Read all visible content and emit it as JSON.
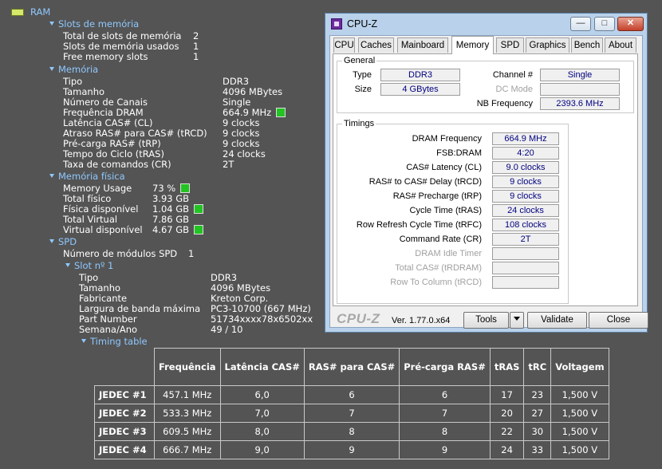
{
  "tree": {
    "ram": "RAM",
    "slots": {
      "header": "Slots de memória",
      "rows": [
        {
          "label": "Total de slots de memória",
          "value": "2"
        },
        {
          "label": "Slots de memória usados",
          "value": "1"
        },
        {
          "label": "Free memory slots",
          "value": "1"
        }
      ]
    },
    "memoria": {
      "header": "Memória",
      "rows": [
        {
          "label": "Tipo",
          "value": "DDR3"
        },
        {
          "label": "Tamanho",
          "value": "4096 MBytes"
        },
        {
          "label": "Número de Canais",
          "value": "Single"
        },
        {
          "label": "Frequência DRAM",
          "value": "664.9 MHz"
        },
        {
          "label": "Latência CAS# (CL)",
          "value": "9 clocks"
        },
        {
          "label": "Atraso RAS# para CAS# (tRCD)",
          "value": "9 clocks"
        },
        {
          "label": "Pré-carga RAS# (tRP)",
          "value": "9 clocks"
        },
        {
          "label": "Tempo do Ciclo (tRAS)",
          "value": "24 clocks"
        },
        {
          "label": "Taxa de comandos (CR)",
          "value": "2T"
        }
      ]
    },
    "fisica": {
      "header": "Memória física",
      "rows": [
        {
          "label": "Memory Usage",
          "value": "73 %"
        },
        {
          "label": "Total físico",
          "value": "3.93 GB"
        },
        {
          "label": "Física disponível",
          "value": "1.04 GB"
        },
        {
          "label": "Total Virtual",
          "value": "7.86 GB"
        },
        {
          "label": "Virtual disponível",
          "value": "4.67 GB"
        }
      ]
    },
    "spd": {
      "header": "SPD",
      "modules_label": "Número de módulos SPD",
      "modules_value": "1",
      "slot_header": "Slot nº 1",
      "rows": [
        {
          "label": "Tipo",
          "value": "DDR3"
        },
        {
          "label": "Tamanho",
          "value": "4096 MBytes"
        },
        {
          "label": "Fabricante",
          "value": "Kreton Corp."
        },
        {
          "label": "Largura de banda máxima",
          "value": "PC3-10700 (667 MHz)"
        },
        {
          "label": "Part Number",
          "value": "51734xxxx78x6502xx"
        },
        {
          "label": "Semana/Ano",
          "value": "49 / 10"
        }
      ],
      "timing_header": "Timing table"
    }
  },
  "timing_table": {
    "headers": [
      "Frequência",
      "Latência CAS#",
      "RAS# para CAS#",
      "Pré-carga RAS#",
      "tRAS",
      "tRC",
      "Voltagem"
    ],
    "rows": [
      {
        "name": "JEDEC #1",
        "cells": [
          "457.1 MHz",
          "6,0",
          "6",
          "6",
          "17",
          "23",
          "1,500 V"
        ]
      },
      {
        "name": "JEDEC #2",
        "cells": [
          "533.3 MHz",
          "7,0",
          "7",
          "7",
          "20",
          "27",
          "1,500 V"
        ]
      },
      {
        "name": "JEDEC #3",
        "cells": [
          "609.5 MHz",
          "8,0",
          "8",
          "8",
          "22",
          "30",
          "1,500 V"
        ]
      },
      {
        "name": "JEDEC #4",
        "cells": [
          "666.7 MHz",
          "9,0",
          "9",
          "9",
          "24",
          "33",
          "1,500 V"
        ]
      }
    ]
  },
  "cpuz": {
    "title": "CPU-Z",
    "tabs": [
      "CPU",
      "Caches",
      "Mainboard",
      "Memory",
      "SPD",
      "Graphics",
      "Bench",
      "About"
    ],
    "active_tab": "Memory",
    "general": {
      "label": "General",
      "type_label": "Type",
      "type_value": "DDR3",
      "size_label": "Size",
      "size_value": "4 GBytes",
      "channel_label": "Channel #",
      "channel_value": "Single",
      "dcmode_label": "DC Mode",
      "dcmode_value": "",
      "nb_label": "NB Frequency",
      "nb_value": "2393.6 MHz"
    },
    "timings": {
      "label": "Timings",
      "rows": [
        {
          "label": "DRAM Frequency",
          "value": "664.9 MHz",
          "enabled": true
        },
        {
          "label": "FSB:DRAM",
          "value": "4:20",
          "enabled": true
        },
        {
          "label": "CAS# Latency (CL)",
          "value": "9.0 clocks",
          "enabled": true
        },
        {
          "label": "RAS# to CAS# Delay (tRCD)",
          "value": "9 clocks",
          "enabled": true
        },
        {
          "label": "RAS# Precharge (tRP)",
          "value": "9 clocks",
          "enabled": true
        },
        {
          "label": "Cycle Time (tRAS)",
          "value": "24 clocks",
          "enabled": true
        },
        {
          "label": "Row Refresh Cycle Time (tRFC)",
          "value": "108 clocks",
          "enabled": true
        },
        {
          "label": "Command Rate (CR)",
          "value": "2T",
          "enabled": true
        },
        {
          "label": "DRAM Idle Timer",
          "value": "",
          "enabled": false
        },
        {
          "label": "Total CAS# (tRDRAM)",
          "value": "",
          "enabled": false
        },
        {
          "label": "Row To Column (tRCD)",
          "value": "",
          "enabled": false
        }
      ]
    },
    "footer": {
      "logo": "CPU-Z",
      "version": "Ver. 1.77.0.x64",
      "tools": "Tools",
      "validate": "Validate",
      "close": "Close"
    },
    "controls": {
      "minimize": "—",
      "maximize": "□",
      "close": "✕"
    }
  }
}
